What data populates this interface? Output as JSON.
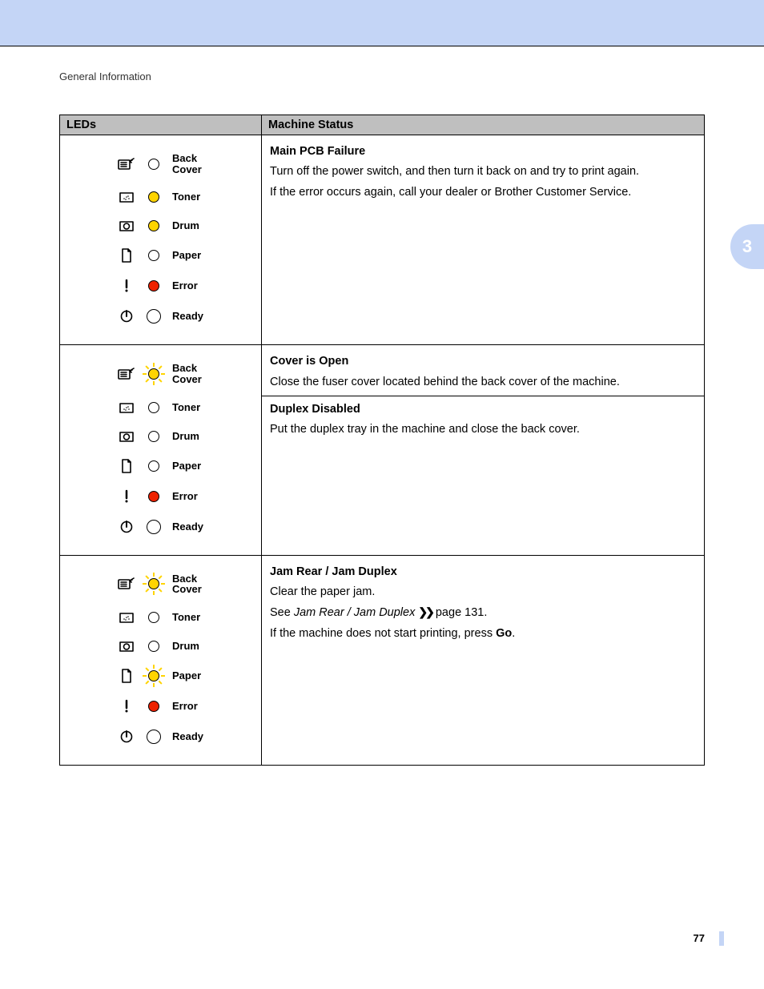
{
  "header": {
    "section": "General Information",
    "chapter_number": "3",
    "page_number": "77"
  },
  "table": {
    "headers": {
      "leds": "LEDs",
      "status": "Machine Status"
    },
    "led_labels": {
      "back_cover_l1": "Back",
      "back_cover_l2": "Cover",
      "toner": "Toner",
      "drum": "Drum",
      "paper": "Paper",
      "error": "Error",
      "ready": "Ready"
    },
    "rows": [
      {
        "leds": {
          "back_cover": "off",
          "toner": "yellow",
          "drum": "yellow",
          "paper": "off",
          "error": "red",
          "ready": "off-big"
        },
        "status": [
          {
            "title": "Main PCB Failure",
            "lines": [
              "Turn off the power switch, and then turn it back on and try to print again.",
              "If the error occurs again, call your dealer or Brother Customer Service."
            ]
          }
        ]
      },
      {
        "leds": {
          "back_cover": "yellow-blink",
          "toner": "off",
          "drum": "off",
          "paper": "off",
          "error": "red",
          "ready": "off-big"
        },
        "status": [
          {
            "title": "Cover is Open",
            "lines": [
              "Close the fuser cover located behind the back cover of the machine."
            ]
          },
          {
            "title": "Duplex Disabled",
            "lines": [
              "Put the duplex tray in the machine and close the back cover."
            ]
          }
        ]
      },
      {
        "leds": {
          "back_cover": "yellow-blink",
          "toner": "off",
          "drum": "off",
          "paper": "yellow-blink",
          "error": "red",
          "ready": "off-big"
        },
        "status": [
          {
            "title": "Jam Rear / Jam Duplex",
            "lines": [
              "Clear the paper jam.",
              {
                "pre": "See ",
                "ital": "Jam Rear / Jam Duplex",
                "chev": true,
                "post": " page 131."
              },
              {
                "pre": "If the machine does not start printing, press ",
                "bold": "Go",
                "post": "."
              }
            ]
          }
        ]
      }
    ]
  }
}
